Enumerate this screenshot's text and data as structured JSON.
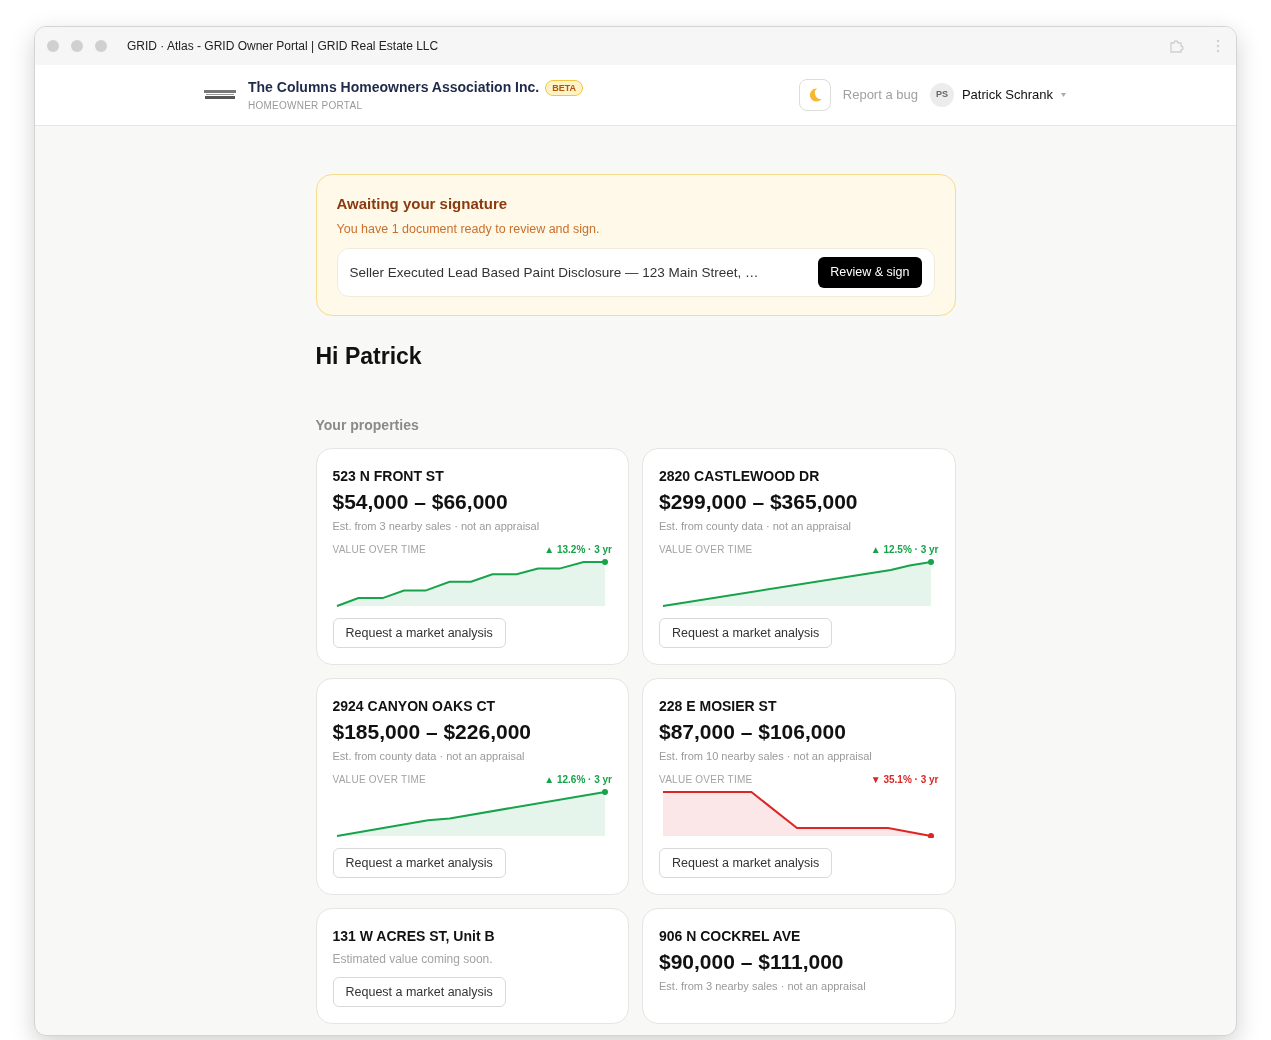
{
  "window": {
    "title": "GRID · Atlas - GRID Owner Portal | GRID Real Estate LLC"
  },
  "header": {
    "org_name": "The Columns Homeowners Association Inc.",
    "badge": "BETA",
    "subtitle": "HOMEOWNER PORTAL",
    "report_link": "Report a bug",
    "user": {
      "initials": "PS",
      "name": "Patrick Schrank"
    }
  },
  "signature_banner": {
    "title": "Awaiting your signature",
    "message": "You have 1 document ready to review and sign.",
    "documents": [
      {
        "name": "Seller Executed Lead Based Paint Disclosure — 123 Main Street, …",
        "action": "Review & sign"
      }
    ]
  },
  "greeting": "Hi Patrick",
  "properties_heading": "Your properties",
  "properties": [
    {
      "kind": "estimate",
      "address": "523 N FRONT ST",
      "range": "$54,000 – $66,000",
      "source": "Est. from 3 nearby sales · not an appraisal",
      "chart_label": "VALUE OVER TIME",
      "color": "#16a34a",
      "change": "▲ 13.2% · 3 yr",
      "action": "Request a market analysis"
    },
    {
      "kind": "estimate",
      "address": "2820 CASTLEWOOD DR",
      "range": "$299,000 – $365,000",
      "source": "Est. from county data · not an appraisal",
      "chart_label": "VALUE OVER TIME",
      "color": "#16a34a",
      "change": "▲ 12.5% · 3 yr",
      "action": "Request a market analysis"
    },
    {
      "kind": "estimate",
      "address": "2924 CANYON OAKS CT",
      "range": "$185,000 – $226,000",
      "source": "Est. from county data · not an appraisal",
      "chart_label": "VALUE OVER TIME",
      "color": "#16a34a",
      "change": "▲ 12.6% · 3 yr",
      "action": "Request a market analysis"
    },
    {
      "kind": "estimate",
      "address": "228 E MOSIER ST",
      "range": "$87,000 – $106,000",
      "source": "Est. from 10 nearby sales · not an appraisal",
      "chart_label": "VALUE OVER TIME",
      "color": "#dc2626",
      "change": "▼ 35.1% · 3 yr",
      "action": "Request a market analysis"
    },
    {
      "kind": "pending",
      "address": "131 W ACRES ST, Unit B",
      "message": "Estimated value coming soon.",
      "action": "Request a market analysis"
    },
    {
      "kind": "estimate",
      "address": "906 N COCKREL AVE",
      "range": "$90,000 – $111,000",
      "source": "Est. from 3 nearby sales · not an appraisal"
    }
  ]
}
